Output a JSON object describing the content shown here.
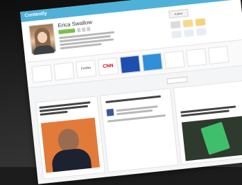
{
  "header": {
    "logo": "Contently"
  },
  "profile": {
    "name": "Erica Swallow",
    "follow_label": "Follow"
  },
  "brands": [
    {
      "name": "CNN",
      "color": "#d0021b"
    },
    {
      "name": "Forbes",
      "color": "#111111"
    }
  ]
}
